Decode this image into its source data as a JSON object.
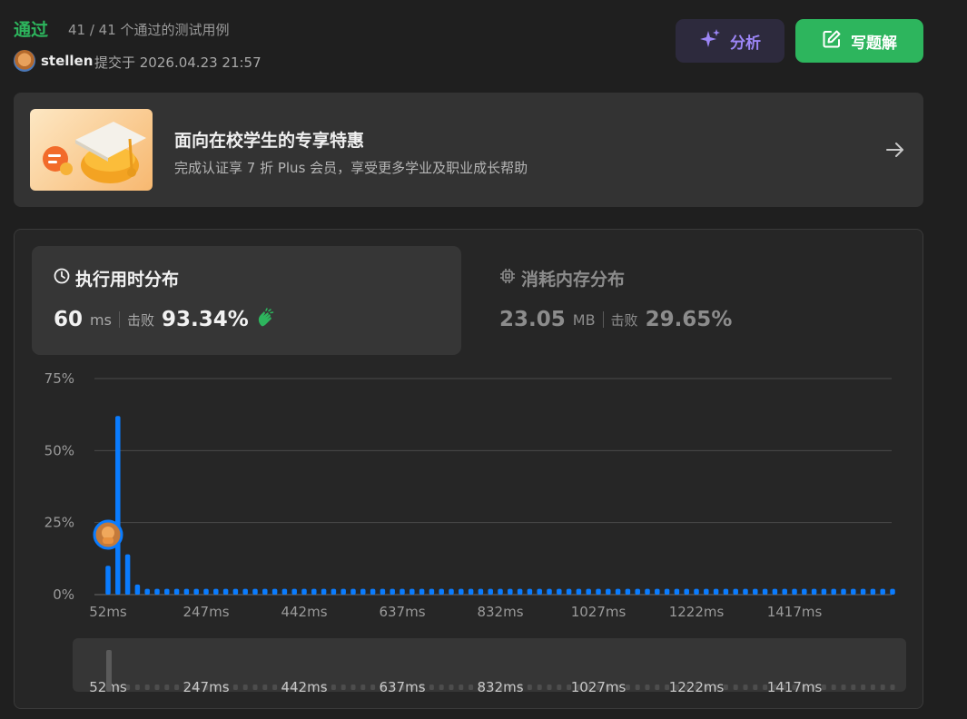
{
  "header": {
    "status": "通过",
    "cases": "41 / 41 个通过的测试用例",
    "username": "stellen",
    "submitted": "提交于 2026.04.23 21:57",
    "analyze_label": "分析",
    "solution_label": "写题解"
  },
  "promo": {
    "title": "面向在校学生的专享特惠",
    "subtitle": "完成认证享 7 折 Plus 会员，享受更多学业及职业成长帮助"
  },
  "runtime": {
    "title": "执行用时分布",
    "value": "60",
    "unit": "ms",
    "beat_label": "击败",
    "beat_pct": "93.34%"
  },
  "memory": {
    "title": "消耗内存分布",
    "value": "23.05",
    "unit": "MB",
    "beat_label": "击败",
    "beat_pct": "29.65%"
  },
  "colors": {
    "accent_green": "#2db55d",
    "bar_blue": "#0a7cff",
    "analyze_purple": "#9c85f6"
  },
  "chart_data": {
    "type": "bar",
    "title": "",
    "xlabel": "",
    "ylabel": "",
    "y_ticks": [
      "75%",
      "50%",
      "25%",
      "0%"
    ],
    "ylim": [
      0,
      75
    ],
    "x_ticks": [
      "52ms",
      "247ms",
      "442ms",
      "637ms",
      "832ms",
      "1027ms",
      "1222ms",
      "1417ms"
    ],
    "bar_count": 81,
    "values": [
      10,
      62,
      14,
      3.5,
      2,
      2,
      2,
      2,
      2,
      2,
      2,
      2,
      2,
      2,
      2,
      2,
      2,
      2,
      2,
      2,
      2,
      2,
      2,
      2,
      2,
      2,
      2,
      2,
      2,
      2,
      2,
      2,
      2,
      2,
      2,
      2,
      2,
      2,
      2,
      2,
      2,
      2,
      2,
      2,
      2,
      2,
      2,
      2,
      2,
      2,
      2,
      2,
      2,
      2,
      2,
      2,
      2,
      2,
      2,
      2,
      2,
      2,
      2,
      2,
      2,
      2,
      2,
      2,
      2,
      2,
      2,
      2,
      2,
      2,
      2,
      2,
      2,
      2,
      2,
      2,
      2
    ],
    "user_marker_index": 1,
    "grid": true
  }
}
